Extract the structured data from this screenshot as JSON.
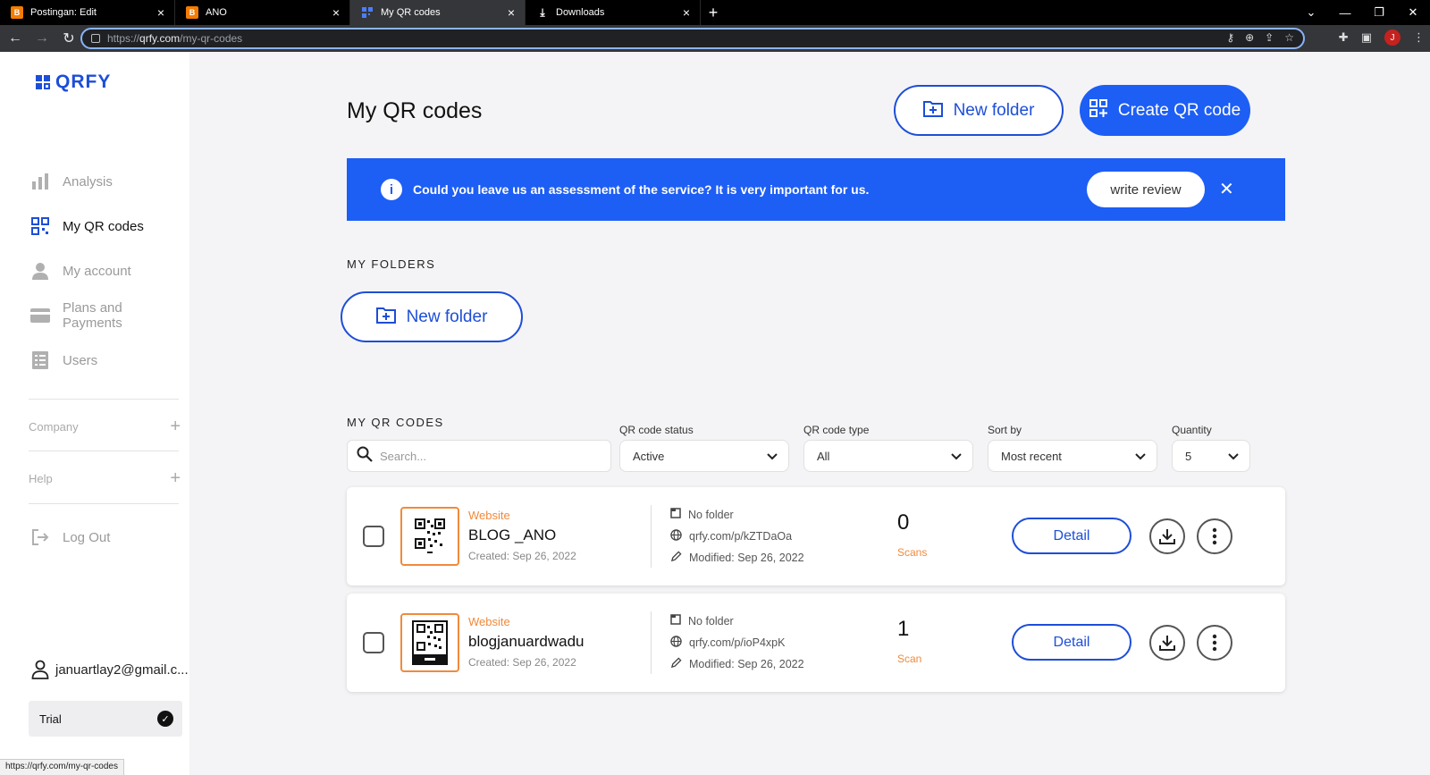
{
  "browser": {
    "tabs": [
      {
        "label": "Postingan: Edit",
        "active": false
      },
      {
        "label": "ANO",
        "active": false
      },
      {
        "label": "My QR codes",
        "active": true
      },
      {
        "label": "Downloads",
        "active": false
      }
    ],
    "url_prefix": "https://",
    "url_host": "qrfy.com",
    "url_path": "/my-qr-codes",
    "profile_initial": "J",
    "status_url": "https://qrfy.com/my-qr-codes"
  },
  "sidebar": {
    "logo": "QRFY",
    "items": [
      {
        "label": "Analysis",
        "icon": "bar-chart-icon",
        "active": false
      },
      {
        "label": "My QR codes",
        "icon": "qr-grid-icon",
        "active": true
      },
      {
        "label": "My account",
        "icon": "person-icon",
        "active": false
      },
      {
        "label": "Plans and Payments",
        "icon": "card-icon",
        "active": false
      },
      {
        "label": "Users",
        "icon": "list-icon",
        "active": false
      }
    ],
    "company_label": "Company",
    "help_label": "Help",
    "logout_label": "Log Out",
    "user_email": "januartlay2@gmail.c...",
    "plan_label": "Trial"
  },
  "main": {
    "title": "My QR codes",
    "new_folder_label": "New folder",
    "create_label": "Create QR code",
    "banner": {
      "message": "Could you leave us an assessment of the service? It is very important for us.",
      "review_label": "write review"
    },
    "folders_heading": "MY FOLDERS",
    "folder_button_label": "New folder",
    "codes_heading": "MY QR CODES",
    "search_placeholder": "Search...",
    "filters": {
      "status_label": "QR code status",
      "status_value": "Active",
      "type_label": "QR code type",
      "type_value": "All",
      "sort_label": "Sort by",
      "sort_value": "Most recent",
      "quantity_label": "Quantity",
      "quantity_value": "5"
    },
    "codes": [
      {
        "type": "Website",
        "name": "BLOG _ANO",
        "created": "Created: Sep 26, 2022",
        "folder": "No folder",
        "link": "qrfy.com/p/kZTDaOa",
        "modified": "Modified: Sep 26, 2022",
        "scans": "0",
        "scans_label": "Scans",
        "detail_label": "Detail"
      },
      {
        "type": "Website",
        "name": "blogjanuardwadu",
        "created": "Created: Sep 26, 2022",
        "folder": "No folder",
        "link": "qrfy.com/p/ioP4xpK",
        "modified": "Modified: Sep 26, 2022",
        "scans": "1",
        "scans_label": "Scan",
        "detail_label": "Detail"
      }
    ]
  },
  "colors": {
    "brand_blue": "#1d5ef5",
    "accent_orange": "#f08a3c"
  }
}
